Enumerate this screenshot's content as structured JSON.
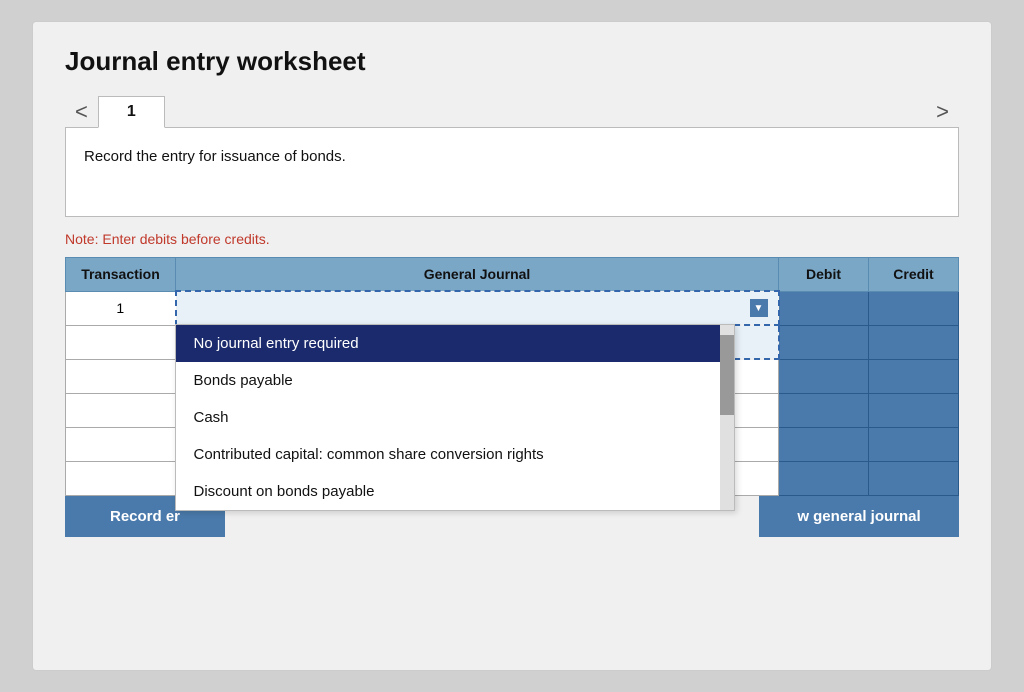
{
  "page": {
    "title": "Journal entry worksheet",
    "tab_prev_label": "<",
    "tab_next_label": ">",
    "tab_number": "1",
    "instruction": "Record the entry for issuance of bonds.",
    "note": "Note: Enter debits before credits.",
    "table": {
      "headers": [
        "Transaction",
        "General Journal",
        "Debit",
        "Credit"
      ],
      "rows": [
        {
          "transaction": "1",
          "journal": "",
          "debit": "",
          "credit": ""
        },
        {
          "transaction": "",
          "journal": "",
          "debit": "",
          "credit": ""
        },
        {
          "transaction": "",
          "journal": "",
          "debit": "",
          "credit": ""
        },
        {
          "transaction": "",
          "journal": "",
          "debit": "",
          "credit": ""
        },
        {
          "transaction": "",
          "journal": "",
          "debit": "",
          "credit": ""
        },
        {
          "transaction": "",
          "journal": "",
          "debit": "",
          "credit": ""
        }
      ]
    },
    "dropdown": {
      "options": [
        "No journal entry required",
        "Bonds payable",
        "Cash",
        "Contributed capital: common share conversion rights",
        "Discount on bonds payable"
      ],
      "selected_index": 0
    },
    "buttons": {
      "record_label": "Record er",
      "view_label": "w general journal"
    }
  }
}
